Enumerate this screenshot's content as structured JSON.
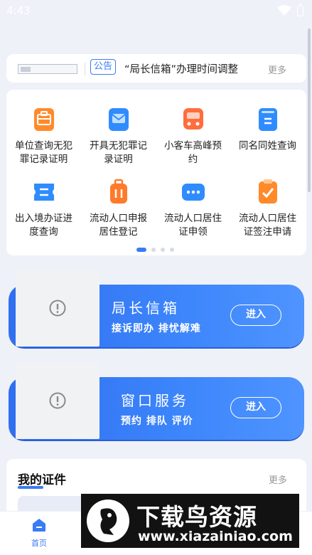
{
  "status_bar": {
    "time": "4:43"
  },
  "notice": {
    "tag": "公告",
    "text": "“局长信箱”办理时间调整",
    "more": "更多"
  },
  "services": {
    "items": [
      {
        "label_1": "单位查询无犯",
        "label_2": "罪记录证明",
        "icon": "briefcase-icon",
        "color": "#ff8a2a"
      },
      {
        "label_1": "开具无犯罪记",
        "label_2": "录证明",
        "icon": "envelope-icon",
        "color": "#2f8cff"
      },
      {
        "label_1": "小客车高峰预",
        "label_2": "约",
        "icon": "bus-icon",
        "color": "#ff6d3d"
      },
      {
        "label_1": "同名同姓查询",
        "label_2": "",
        "icon": "document-icon",
        "color": "#2f8cff"
      },
      {
        "label_1": "出入境办证进",
        "label_2": "度查询",
        "icon": "ticket-icon",
        "color": "#2f8cff"
      },
      {
        "label_1": "流动人口申报",
        "label_2": "居住登记",
        "icon": "luggage-icon",
        "color": "#ff7a2a"
      },
      {
        "label_1": "流动人口居住",
        "label_2": "证申领",
        "icon": "chat-card-icon",
        "color": "#2f8cff"
      },
      {
        "label_1": "流动人口居住",
        "label_2": "证签注申请",
        "icon": "checklist-icon",
        "color": "#ff8a2a"
      }
    ],
    "page_count": 4,
    "active_page": 1
  },
  "banners": [
    {
      "title": "局长信箱",
      "subtitle": "接诉即办 排忧解难",
      "button": "进入"
    },
    {
      "title": "窗口服务",
      "subtitle": "预约 排队 评价",
      "button": "进入"
    }
  ],
  "certificates": {
    "title": "我的证件",
    "more": "更多"
  },
  "bottom_nav": {
    "items": [
      {
        "label": "首页",
        "icon": "home-icon",
        "active": true
      }
    ]
  },
  "watermark": {
    "title": "下载鸟资源",
    "url": "www.xiazainiao.com"
  },
  "colors": {
    "accent": "#3a7bf6",
    "background": "#eef1f8"
  }
}
